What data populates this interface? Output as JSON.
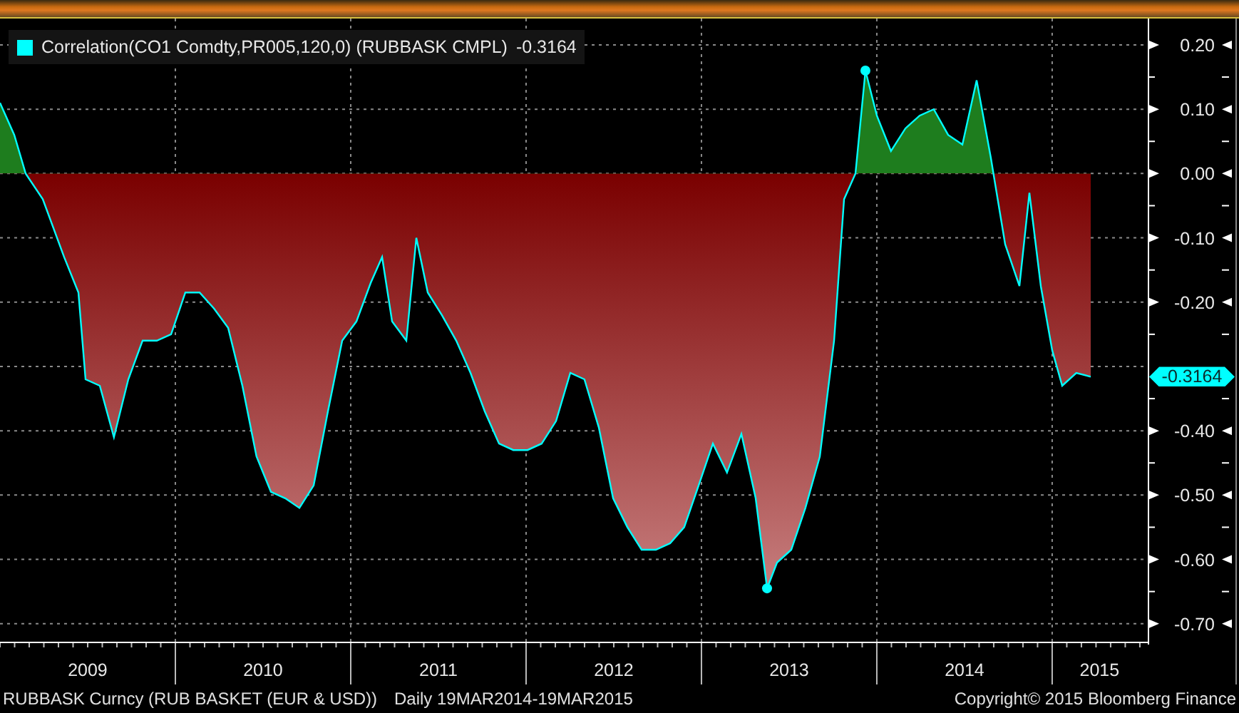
{
  "chart": {
    "legend_value": "-0.3164",
    "last_value": "-0.3164",
    "chart_data": {
      "type": "area",
      "grid": true,
      "xlim": [
        2009,
        2015.545
      ],
      "ylim": [
        -0.728,
        0.241
      ],
      "x": [
        2009.0,
        2009.081,
        2009.146,
        2009.244,
        2009.366,
        2009.447,
        2009.488,
        2009.569,
        2009.65,
        2009.732,
        2009.813,
        2009.894,
        2009.976,
        2010.057,
        2010.138,
        2010.22,
        2010.301,
        2010.382,
        2010.463,
        2010.545,
        2010.626,
        2010.707,
        2010.789,
        2010.87,
        2010.951,
        2011.033,
        2011.114,
        2011.179,
        2011.236,
        2011.317,
        2011.374,
        2011.439,
        2011.52,
        2011.602,
        2011.683,
        2011.764,
        2011.846,
        2011.927,
        2012.008,
        2012.089,
        2012.171,
        2012.252,
        2012.333,
        2012.415,
        2012.496,
        2012.577,
        2012.659,
        2012.74,
        2012.821,
        2012.902,
        2012.984,
        2013.065,
        2013.146,
        2013.228,
        2013.309,
        2013.374,
        2013.431,
        2013.512,
        2013.593,
        2013.675,
        2013.756,
        2013.813,
        2013.878,
        2013.935,
        2014.0,
        2014.081,
        2014.163,
        2014.244,
        2014.325,
        2014.407,
        2014.488,
        2014.569,
        2014.65,
        2014.732,
        2014.813,
        2014.87,
        2014.935,
        2015.0,
        2015.057,
        2015.138,
        2015.22
      ],
      "series": [
        {
          "name": "Correlation(CO1 Comdty,PR005,120,0) (RUBBASK CMPL)",
          "color": "#00ffff",
          "values": [
            0.11,
            0.06,
            0.0,
            -0.04,
            -0.13,
            -0.185,
            -0.32,
            -0.33,
            -0.41,
            -0.32,
            -0.26,
            -0.26,
            -0.25,
            -0.185,
            -0.185,
            -0.21,
            -0.24,
            -0.33,
            -0.44,
            -0.495,
            -0.505,
            -0.52,
            -0.485,
            -0.37,
            -0.26,
            -0.23,
            -0.17,
            -0.13,
            -0.23,
            -0.26,
            -0.1,
            -0.185,
            -0.22,
            -0.26,
            -0.31,
            -0.37,
            -0.42,
            -0.43,
            -0.43,
            -0.42,
            -0.385,
            -0.31,
            -0.32,
            -0.395,
            -0.505,
            -0.55,
            -0.585,
            -0.585,
            -0.575,
            -0.55,
            -0.485,
            -0.42,
            -0.465,
            -0.405,
            -0.505,
            -0.645,
            -0.605,
            -0.585,
            -0.52,
            -0.44,
            -0.26,
            -0.04,
            0.0,
            0.16,
            0.09,
            0.035,
            0.07,
            0.09,
            0.1,
            0.06,
            0.045,
            0.145,
            0.025,
            -0.11,
            -0.175,
            -0.03,
            -0.175,
            -0.275,
            -0.33,
            -0.31,
            -0.316
          ]
        }
      ],
      "xticks": [
        {
          "value": 2009.5,
          "label": "2009"
        },
        {
          "value": 2010.5,
          "label": "2010"
        },
        {
          "value": 2011.5,
          "label": "2011"
        },
        {
          "value": 2012.5,
          "label": "2012"
        },
        {
          "value": 2013.5,
          "label": "2013"
        },
        {
          "value": 2014.5,
          "label": "2014"
        },
        {
          "value": 2015.27,
          "label": "2015"
        }
      ],
      "yticks": [
        {
          "value": 0.2,
          "label": "0.20"
        },
        {
          "value": 0.1,
          "label": "0.10"
        },
        {
          "value": 0,
          "label": "0.00"
        },
        {
          "value": -0.1,
          "label": "-0.10"
        },
        {
          "value": -0.2,
          "label": "-0.20"
        },
        {
          "value": -0.4,
          "label": "-0.40"
        },
        {
          "value": -0.5,
          "label": "-0.50"
        },
        {
          "value": -0.6,
          "label": "-0.60"
        },
        {
          "value": -0.7,
          "label": "-0.70"
        }
      ]
    }
  },
  "footer": {
    "security": "RUBBASK Curncy (RUB BASKET (EUR & USD))",
    "range": "Daily 19MAR2014-19MAR2015",
    "copyright": "Copyright© 2015 Bloomberg Finance"
  }
}
